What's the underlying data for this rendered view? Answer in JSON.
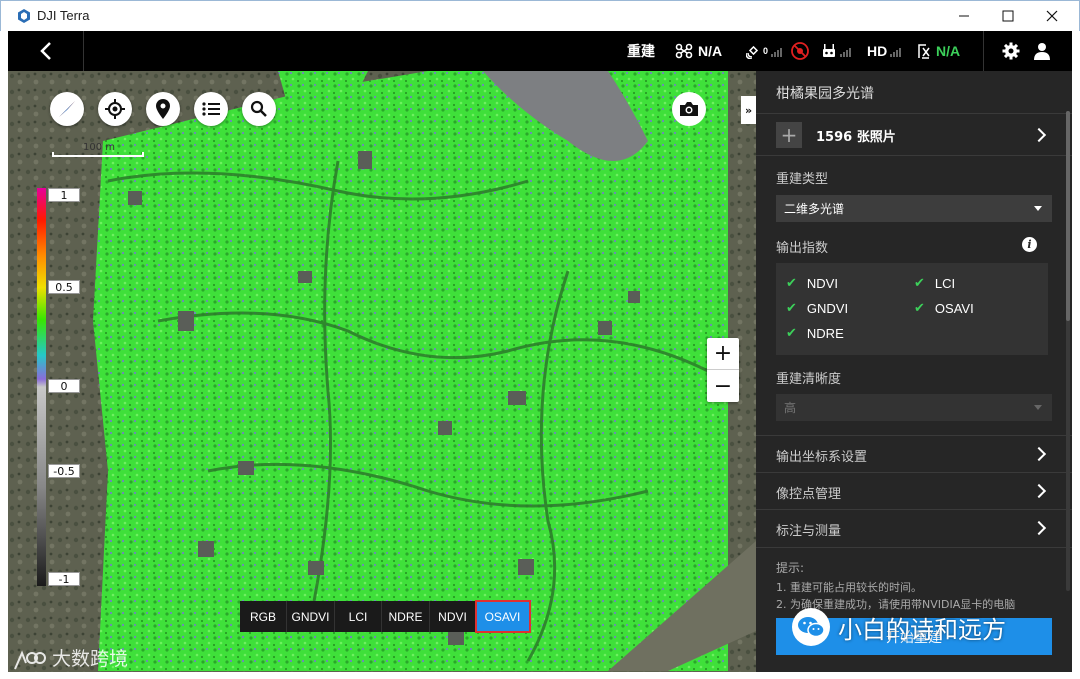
{
  "window": {
    "title": "DJI Terra",
    "min": "—",
    "max": "☐",
    "close": "✕"
  },
  "topbar": {
    "back_icon": "chevron-left-icon",
    "mode": "重建",
    "drone_status": "N/A",
    "hd_label": "HD",
    "battery_status": "N/A",
    "accent_green": "#3cd05a"
  },
  "map": {
    "scale_label": "100 m",
    "legend_ticks": [
      "1",
      "0.5",
      "0",
      "-0.5",
      "-1"
    ],
    "zoom_in": "+",
    "zoom_out": "−",
    "collapse": "»",
    "index_tabs": [
      {
        "label": "RGB",
        "active": false
      },
      {
        "label": "GNDVI",
        "active": false
      },
      {
        "label": "LCI",
        "active": false
      },
      {
        "label": "NDRE",
        "active": false
      },
      {
        "label": "NDVI",
        "active": false
      },
      {
        "label": "OSAVI",
        "active": true
      }
    ],
    "watermark": "大数跨境"
  },
  "panel": {
    "title": "柑橘果园多光谱",
    "photos": "1596 张照片",
    "add_icon": "plus-icon",
    "recon_type_label": "重建类型",
    "recon_type_value": "二维多光谱",
    "output_index_label": "输出指数",
    "info_icon": "i",
    "indices": [
      {
        "name": "NDVI",
        "checked": true
      },
      {
        "name": "LCI",
        "checked": true
      },
      {
        "name": "GNDVI",
        "checked": true
      },
      {
        "name": "OSAVI",
        "checked": true
      },
      {
        "name": "NDRE",
        "checked": true
      }
    ],
    "check_mark": "✔",
    "resolution_label": "重建清晰度",
    "resolution_value": "高",
    "coord_settings": "输出坐标系设置",
    "gcp": "像控点管理",
    "annotate": "标注与测量",
    "tips_title": "提示:",
    "tips": [
      "1. 重建可能占用较长的时间。",
      "2. 为确保重建成功，请使用带NVIDIA显卡的电脑"
    ],
    "start_button": "开始重建",
    "accent_blue": "#1e8fe8"
  },
  "watermark_right": "小白的诗和远方"
}
